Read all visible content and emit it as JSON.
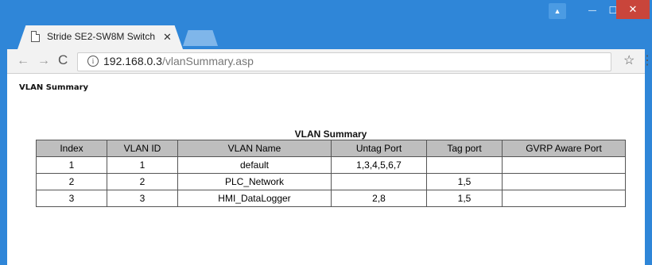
{
  "browser": {
    "tab_title": "Stride SE2-SW8M Switch",
    "tab_close": "✕",
    "url_host": "192.168.0.3",
    "url_path": "/vlanSummary.asp",
    "info_symbol": "i",
    "back_symbol": "←",
    "forward_symbol": "→",
    "reload_symbol": "C",
    "star_symbol": "☆",
    "menu_symbol": "⋮",
    "min_symbol": "—",
    "max_symbol": "☐",
    "close_symbol": "✕",
    "user_symbol": "▲"
  },
  "page": {
    "heading": "VLAN Summary",
    "table_caption": "VLAN Summary",
    "columns": {
      "index": "Index",
      "vlan_id": "VLAN ID",
      "vlan_name": "VLAN Name",
      "untag_port": "Untag Port",
      "tag_port": "Tag port",
      "gvrp": "GVRP Aware Port"
    },
    "rows": [
      {
        "index": "1",
        "vlan_id": "1",
        "vlan_name": "default",
        "untag_port": "1,3,4,5,6,7",
        "tag_port": "",
        "gvrp": ""
      },
      {
        "index": "2",
        "vlan_id": "2",
        "vlan_name": "PLC_Network",
        "untag_port": "",
        "tag_port": "1,5",
        "gvrp": ""
      },
      {
        "index": "3",
        "vlan_id": "3",
        "vlan_name": "HMI_DataLogger",
        "untag_port": "2,8",
        "tag_port": "1,5",
        "gvrp": ""
      }
    ]
  }
}
